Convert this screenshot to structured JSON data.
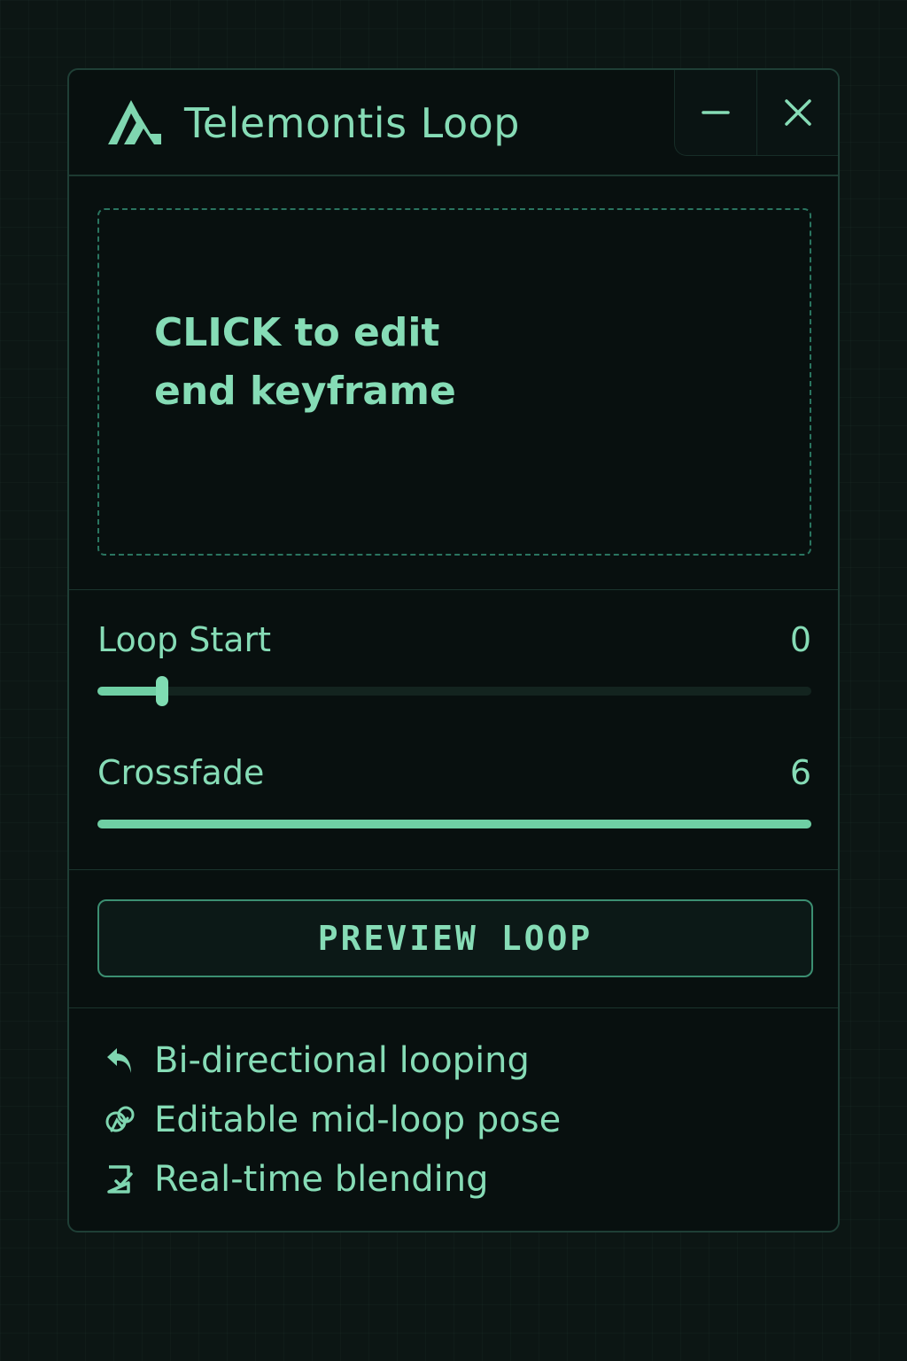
{
  "window": {
    "title": "Telemontis Loop",
    "logo_icon": "telemontis-logo-icon",
    "minimize_icon": "minimize-icon",
    "close_icon": "close-icon"
  },
  "keyframe_zone": {
    "text": "CLICK to edit\nend keyframe"
  },
  "sliders": {
    "loop_start": {
      "label": "Loop Start",
      "value": "0",
      "fill_fraction": 0.09
    },
    "crossfade": {
      "label": "Crossfade",
      "value": "6",
      "fill_fraction": 1.0
    }
  },
  "preview_button": {
    "label": "PREVIEW LOOP"
  },
  "features": [
    {
      "icon": "reply-arrow-icon",
      "label": "Bi-directional looping"
    },
    {
      "icon": "pose-figure-icon",
      "label": "Editable mid-loop pose"
    },
    {
      "icon": "blend-document-icon",
      "label": "Real-time blending"
    }
  ],
  "colors": {
    "accent": "#86dcb6",
    "background": "#0c1614",
    "panel": "#08100f",
    "border": "#1f3f36"
  }
}
